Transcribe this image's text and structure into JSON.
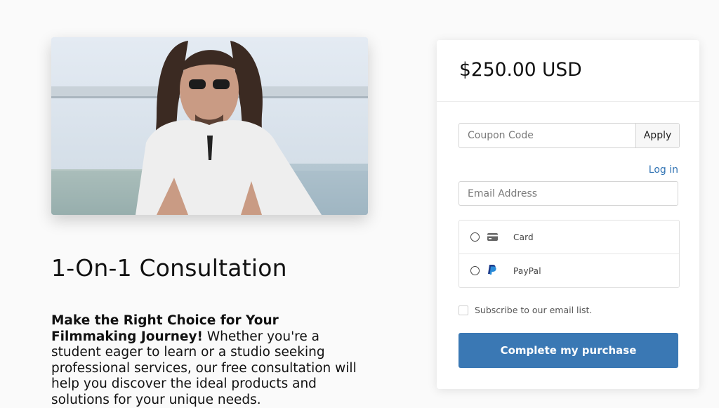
{
  "product": {
    "title": "1-On-1 Consultation",
    "description_bold": "Make the Right Choice for Your Filmmaking Journey!",
    "description_text": " Whether you're a student eager to learn or a studio seeking professional services, our free consultation will help you discover the ideal products and solutions for your unique needs."
  },
  "checkout": {
    "price": "$250.00 USD",
    "coupon_placeholder": "Coupon Code",
    "apply_label": "Apply",
    "login_label": "Log in",
    "email_placeholder": "Email Address",
    "payment_methods": [
      {
        "label": "Card",
        "icon": "credit-card-icon"
      },
      {
        "label": "PayPal",
        "icon": "paypal-icon"
      }
    ],
    "subscribe_label": "Subscribe to our email list.",
    "purchase_label": "Complete my purchase"
  },
  "colors": {
    "accent": "#3a78b4",
    "link": "#2f72b3",
    "background": "#fafafa"
  }
}
